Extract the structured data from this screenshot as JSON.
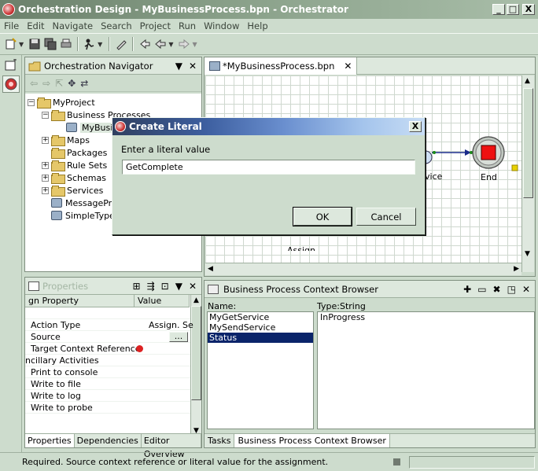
{
  "window": {
    "title": "Orchestration Design - MyBusinessProcess.bpn - Orchestrator",
    "minimize": "_",
    "maximize": "□",
    "close": "X"
  },
  "menu": [
    {
      "label": "File"
    },
    {
      "label": "Edit"
    },
    {
      "label": "Navigate"
    },
    {
      "label": "Search"
    },
    {
      "label": "Project"
    },
    {
      "label": "Run"
    },
    {
      "label": "Window"
    },
    {
      "label": "Help"
    }
  ],
  "navigator": {
    "title": "Orchestration Navigator",
    "tree": [
      {
        "label": "MyProject",
        "depth": 0,
        "twisty": "−",
        "icon": "folder-open-icon"
      },
      {
        "label": "Business Processes",
        "depth": 1,
        "twisty": "−",
        "icon": "folder-open-icon"
      },
      {
        "label": "MyBusi",
        "depth": 2,
        "twisty": "",
        "icon": "process-icon"
      },
      {
        "label": "Maps",
        "depth": 1,
        "twisty": "+",
        "icon": "folder-icon"
      },
      {
        "label": "Packages",
        "depth": 1,
        "twisty": "",
        "icon": "folder-icon"
      },
      {
        "label": "Rule Sets",
        "depth": 1,
        "twisty": "+",
        "icon": "folder-icon"
      },
      {
        "label": "Schemas",
        "depth": 1,
        "twisty": "+",
        "icon": "folder-icon"
      },
      {
        "label": "Services",
        "depth": 1,
        "twisty": "+",
        "icon": "folder-icon"
      },
      {
        "label": "MessagePr",
        "depth": 1,
        "twisty": "",
        "icon": "db-icon"
      },
      {
        "label": "SimpleType",
        "depth": 1,
        "twisty": "",
        "icon": "db-icon"
      }
    ]
  },
  "editor": {
    "tab_label": "*MyBusinessProcess.bpn",
    "nodes": {
      "service_label": "vice",
      "end_label": "End",
      "assign_label": "Assign"
    }
  },
  "properties": {
    "title": "Properties",
    "columns": [
      "gn Property",
      "Value"
    ],
    "rows": [
      {
        "name": "",
        "value": ""
      },
      {
        "name": "Action Type",
        "value": "Assign. Se"
      },
      {
        "name": "Source",
        "value": "..."
      },
      {
        "name": "Target Context Reference",
        "value": ""
      },
      {
        "name": "ncillary Activities",
        "value": ""
      },
      {
        "name": "Print to console",
        "value": ""
      },
      {
        "name": "Write to file",
        "value": ""
      },
      {
        "name": "Write to log",
        "value": ""
      },
      {
        "name": "Write to probe",
        "value": ""
      }
    ],
    "tabs": [
      "Properties",
      "Dependencies",
      "Editor Overview"
    ]
  },
  "context_browser": {
    "title": "Business Process Context Browser",
    "name_header": "Name:",
    "type_header": "Type:String",
    "items": [
      "MyGetService",
      "MySendService",
      "Status"
    ],
    "selected_index": 2,
    "value": "InProgress",
    "tabs": [
      "Tasks",
      "Business Process Context Browser"
    ]
  },
  "status": {
    "message": "Required. Source context reference or literal value for the assignment."
  },
  "dialog": {
    "title": "Create Literal",
    "prompt": "Enter a literal value",
    "input_value": "GetComplete",
    "ok_label": "OK",
    "cancel_label": "Cancel",
    "close": "X"
  }
}
